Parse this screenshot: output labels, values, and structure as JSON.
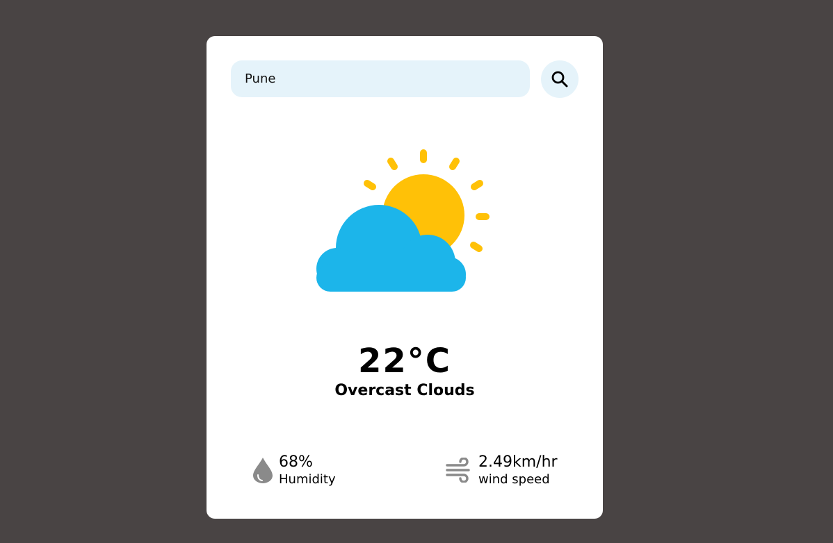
{
  "search": {
    "value": "Pune",
    "icon": "search-icon"
  },
  "weather": {
    "icon": "partly-cloudy-icon",
    "temperature": "22°C",
    "condition": "Overcast Clouds"
  },
  "details": {
    "humidity": {
      "value": "68%",
      "label": "Humidity",
      "icon": "humidity-drop-icon"
    },
    "wind": {
      "value": "2.49km/hr",
      "label": "wind speed",
      "icon": "wind-icon"
    }
  },
  "colors": {
    "background": "#494444",
    "card": "#ffffff",
    "search_fill": "#e5f3fa",
    "sun": "#ffc107",
    "cloud": "#1cb5ea",
    "detail_icon": "#888888"
  }
}
